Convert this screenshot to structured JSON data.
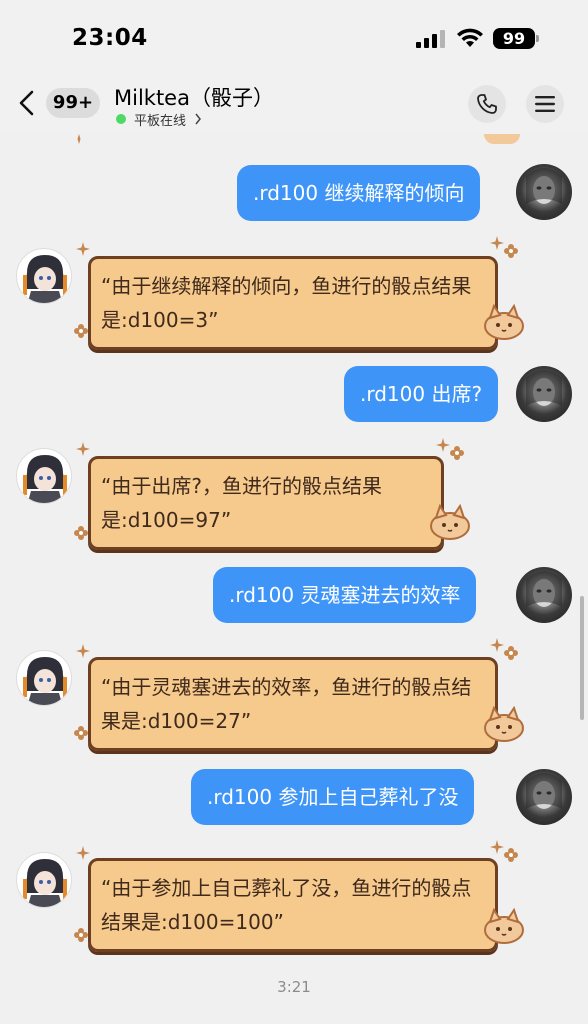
{
  "status_bar": {
    "time": "23:04",
    "battery": "99"
  },
  "header": {
    "unread": "99+",
    "title": "Milktea（骰子）",
    "online_status": "平板在线"
  },
  "messages": [
    {
      "side": "out",
      "text": ".rd100 继续解释的倾向"
    },
    {
      "side": "in",
      "text": "“由于继续解释的倾向，鱼进行的骰点结果是:d100=3”"
    },
    {
      "side": "out",
      "text": ".rd100 出席?"
    },
    {
      "side": "in",
      "text": "“由于出席?，鱼进行的骰点结果是:d100=97”"
    },
    {
      "side": "out",
      "text": ".rd100 灵魂塞进去的效率"
    },
    {
      "side": "in",
      "text": "“由于灵魂塞进去的效率，鱼进行的骰点结果是:d100=27”"
    },
    {
      "side": "out",
      "text": ".rd100 参加上自己葬礼了没"
    },
    {
      "side": "in",
      "text": "“由于参加上自己葬礼了没，鱼进行的骰点结果是:d100=100”"
    }
  ],
  "footer_time": "3:21",
  "colors": {
    "outgoing_bubble": "#3e95f7",
    "incoming_bubble": "#f6c98c",
    "incoming_border": "#6d4023",
    "online_dot": "#4cd964"
  }
}
